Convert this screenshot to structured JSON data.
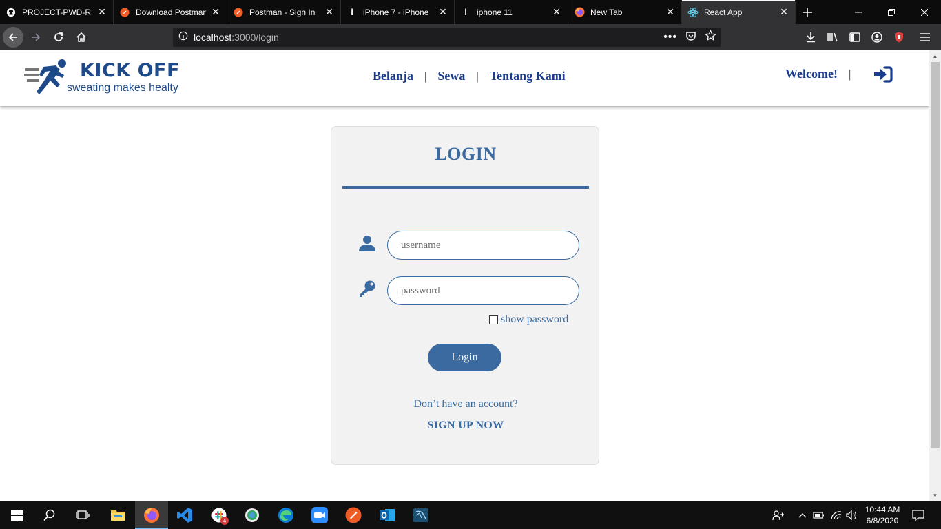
{
  "browser": {
    "tabs": [
      {
        "title": "PROJECT-PWD-REA",
        "icon": "github-icon",
        "active": false
      },
      {
        "title": "Download Postman",
        "icon": "postman-icon",
        "active": false
      },
      {
        "title": "Postman - Sign In",
        "icon": "postman-icon",
        "active": false
      },
      {
        "title": "iPhone 7 - iPhone",
        "icon": "info-icon",
        "active": false
      },
      {
        "title": "iphone 11",
        "icon": "info-icon",
        "active": false
      },
      {
        "title": "New Tab",
        "icon": "firefox-icon",
        "active": false
      },
      {
        "title": "React App",
        "icon": "react-icon",
        "active": true
      }
    ],
    "url_host": "localhost",
    "url_path": ":3000/login",
    "colors": {
      "chrome_dark": "#0c0c0d",
      "toolbar": "#323234",
      "urlbar": "#1d1d1f"
    }
  },
  "site": {
    "logo_title": "KICK OFF",
    "logo_subtitle": "sweating makes healty",
    "menu": [
      "Belanja",
      "Sewa",
      "Tentang Kami"
    ],
    "separator": "|",
    "welcome": "Welcome!",
    "colors": {
      "brand": "#1e4a8a",
      "nav": "#1a3c8e",
      "accent": "#3a6aa0"
    }
  },
  "login": {
    "title": "LOGIN",
    "username_placeholder": "username",
    "password_placeholder": "password",
    "show_password_label": "show password",
    "show_password_checked": false,
    "button_label": "Login",
    "no_account_text": "Don’t have an account?",
    "signup_label": "SIGN UP NOW"
  },
  "taskbar": {
    "time": "10:44 AM",
    "date": "6/8/2020",
    "slack_badge": "4"
  }
}
